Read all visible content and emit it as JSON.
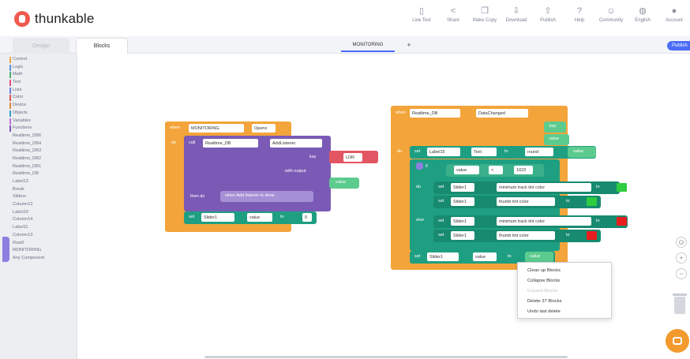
{
  "app": {
    "logo_text": "thunkable",
    "brand_color": "#f05a4f",
    "accent_color": "#4a6cf7"
  },
  "topnav": [
    {
      "label": "Live Test",
      "icon": "phone-icon"
    },
    {
      "label": "Share",
      "icon": "share-icon"
    },
    {
      "label": "Make Copy",
      "icon": "copy-icon"
    },
    {
      "label": "Download",
      "icon": "download-icon"
    },
    {
      "label": "Publish",
      "icon": "publish-icon"
    },
    {
      "label": "Help",
      "icon": "help-icon"
    },
    {
      "label": "Community",
      "icon": "community-icon"
    },
    {
      "label": "English",
      "icon": "globe-icon"
    },
    {
      "label": "Account",
      "icon": "account-icon"
    }
  ],
  "tabs": {
    "design": "Design",
    "blocks": "Blocks",
    "screen": "MONITORING",
    "add": "+",
    "publish_badge": "Publish"
  },
  "sidebar": [
    {
      "label": "Control",
      "color": "#f3a43a"
    },
    {
      "label": "Logic",
      "color": "#5c8fd6"
    },
    {
      "label": "Math",
      "color": "#4fb06b"
    },
    {
      "label": "Text",
      "color": "#e0527a"
    },
    {
      "label": "Lists",
      "color": "#6a7fd8"
    },
    {
      "label": "Color",
      "color": "#d9534f"
    },
    {
      "label": "Device",
      "color": "#e08a3c"
    },
    {
      "label": "Objects",
      "color": "#3aa0c8"
    },
    {
      "label": "Variables",
      "color": "#c56bd6"
    },
    {
      "label": "Functions",
      "color": "#7a5ab6"
    },
    {
      "label": "Realtime_DB6"
    },
    {
      "label": "Realtime_DB4"
    },
    {
      "label": "Realtime_DB3"
    },
    {
      "label": "Realtime_DB2"
    },
    {
      "label": "Realtime_DB1"
    },
    {
      "label": "Realtime_DB"
    },
    {
      "label": "Label13"
    },
    {
      "label": "Break"
    },
    {
      "label": "Sliders"
    },
    {
      "label": "Column12"
    },
    {
      "label": "Label10"
    },
    {
      "label": "Column14"
    },
    {
      "label": "Label11"
    },
    {
      "label": "Column13"
    },
    {
      "label": "Row0"
    },
    {
      "label": "MONITORING"
    },
    {
      "label": "Any Component"
    }
  ],
  "blocks_left": {
    "when": "when",
    "component": "MONITORING",
    "event": "Opens",
    "do": "do",
    "call": "call",
    "db": "Realtime_DB",
    "method": "AddListener",
    "key_label": "key",
    "key_value": "LDR",
    "with_output": "with output",
    "value": "value",
    "then_do": "then do",
    "callback": "when Add listener is done",
    "set": "set",
    "slider": "Slider1",
    "prop": "value",
    "to": "to",
    "zero": "0"
  },
  "blocks_right": {
    "when": "when",
    "db": "Realtime_DB",
    "event": "DataChanged",
    "key": "key",
    "value": "value",
    "do": "do",
    "set": "set",
    "label": "Label15",
    "text_prop": "Text",
    "to": "to",
    "round": "round",
    "if": "if",
    "cmp_value": "value",
    "cmp_op": "<",
    "cmp_num": "1023",
    "slider": "Slider1",
    "min_track": "minimum track tint color",
    "thumb": "thumb tint color",
    "else": "else",
    "value_prop": "value",
    "green": "#2ecc40",
    "red": "#e81e1e"
  },
  "context_menu": [
    {
      "label": "Clean up Blocks",
      "enabled": true
    },
    {
      "label": "Collapse Blocks",
      "enabled": true
    },
    {
      "label": "Expand Blocks",
      "enabled": false
    },
    {
      "label": "Delete 37 Blocks",
      "enabled": true
    },
    {
      "label": "Undo last delete",
      "enabled": true
    }
  ],
  "zoom": {
    "center": "⊙",
    "in": "+",
    "out": "−"
  }
}
